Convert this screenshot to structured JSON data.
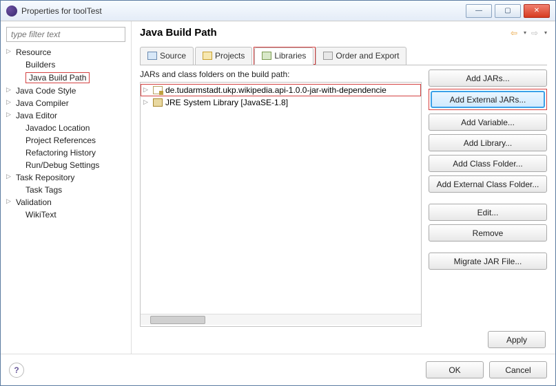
{
  "window": {
    "title": "Properties for toolTest"
  },
  "filter": {
    "placeholder": "type filter text"
  },
  "tree": {
    "items": [
      {
        "label": "Resource"
      },
      {
        "label": "Builders"
      },
      {
        "label": "Java Build Path"
      },
      {
        "label": "Java Code Style"
      },
      {
        "label": "Java Compiler"
      },
      {
        "label": "Java Editor"
      },
      {
        "label": "Javadoc Location"
      },
      {
        "label": "Project References"
      },
      {
        "label": "Refactoring History"
      },
      {
        "label": "Run/Debug Settings"
      },
      {
        "label": "Task Repository"
      },
      {
        "label": "Task Tags"
      },
      {
        "label": "Validation"
      },
      {
        "label": "WikiText"
      }
    ]
  },
  "page": {
    "title": "Java Build Path"
  },
  "tabs": {
    "source": "Source",
    "projects": "Projects",
    "libraries": "Libraries",
    "order": "Order and Export"
  },
  "list": {
    "label": "JARs and class folders on the build path:",
    "items": [
      {
        "label": "de.tudarmstadt.ukp.wikipedia.api-1.0.0-jar-with-dependencie"
      },
      {
        "label": "JRE System Library [JavaSE-1.8]"
      }
    ]
  },
  "buttons": {
    "addJars": "Add JARs...",
    "addExternalJars": "Add External JARs...",
    "addVariable": "Add Variable...",
    "addLibrary": "Add Library...",
    "addClassFolder": "Add Class Folder...",
    "addExternalClassFolder": "Add External Class Folder...",
    "edit": "Edit...",
    "remove": "Remove",
    "migrate": "Migrate JAR File...",
    "apply": "Apply",
    "ok": "OK",
    "cancel": "Cancel"
  }
}
